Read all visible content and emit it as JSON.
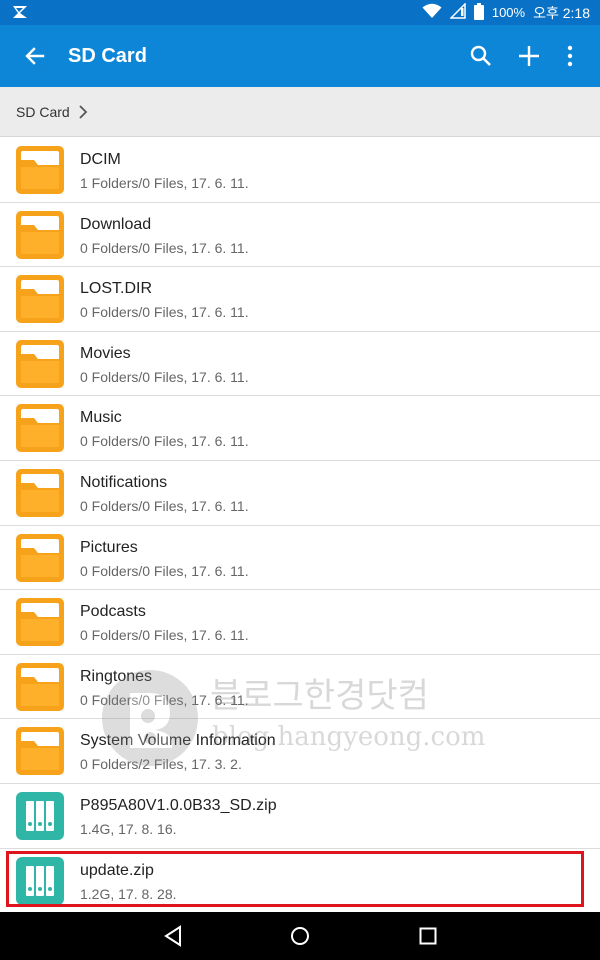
{
  "status_bar": {
    "battery": "100%",
    "time": "오후 2:18",
    "icons": [
      "notification-icon",
      "wifi-icon",
      "signal-icon",
      "battery-icon"
    ]
  },
  "app_bar": {
    "title": "SD Card",
    "icons": [
      "back-arrow-icon",
      "search-icon",
      "add-icon",
      "more-vert-icon"
    ]
  },
  "breadcrumb": {
    "path": "SD Card"
  },
  "files": [
    {
      "name": "DCIM",
      "meta": "1 Folders/0 Files, 17. 6. 11.",
      "type": "folder"
    },
    {
      "name": "Download",
      "meta": "0 Folders/0 Files, 17. 6. 11.",
      "type": "folder"
    },
    {
      "name": "LOST.DIR",
      "meta": "0 Folders/0 Files, 17. 6. 11.",
      "type": "folder"
    },
    {
      "name": "Movies",
      "meta": "0 Folders/0 Files, 17. 6. 11.",
      "type": "folder"
    },
    {
      "name": "Music",
      "meta": "0 Folders/0 Files, 17. 6. 11.",
      "type": "folder"
    },
    {
      "name": "Notifications",
      "meta": "0 Folders/0 Files, 17. 6. 11.",
      "type": "folder"
    },
    {
      "name": "Pictures",
      "meta": "0 Folders/0 Files, 17. 6. 11.",
      "type": "folder"
    },
    {
      "name": "Podcasts",
      "meta": "0 Folders/0 Files, 17. 6. 11.",
      "type": "folder"
    },
    {
      "name": "Ringtones",
      "meta": "0 Folders/0 Files, 17. 6. 11.",
      "type": "folder"
    },
    {
      "name": "System Volume Information",
      "meta": "0 Folders/2 Files, 17. 3. 2.",
      "type": "folder"
    },
    {
      "name": "P895A80V1.0.0B33_SD.zip",
      "meta": "1.4G, 17. 8. 16.",
      "type": "zip"
    },
    {
      "name": "update.zip",
      "meta": "1.2G, 17. 8. 28.",
      "type": "zip",
      "highlighted": true
    }
  ],
  "watermark": {
    "title": "블로그한경닷컴",
    "url": "blog.hangyeong.com"
  },
  "nav_bar": {
    "icons": [
      "nav-back-icon",
      "nav-home-icon",
      "nav-recents-icon"
    ]
  },
  "colors": {
    "status_bar": "#0a72c6",
    "app_bar": "#0d86d8",
    "breadcrumb_bg": "#ececec",
    "folder": "#f7a21b",
    "zip": "#2fb6a6",
    "highlight": "#e0141c"
  }
}
